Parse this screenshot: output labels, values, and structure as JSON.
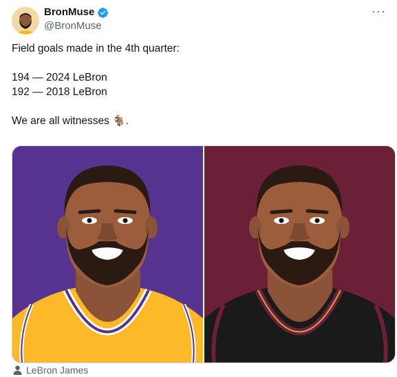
{
  "user": {
    "display_name": "BronMuse",
    "handle": "@BronMuse"
  },
  "more_label": "···",
  "tweet": {
    "line1": "Field goals made in the 4th quarter:",
    "line2": "194 — 2024 LeBron",
    "line3": "192 — 2018 LeBron",
    "line4": "We are all witnesses 🐐."
  },
  "media": {
    "left_colors": {
      "background": "#55338e",
      "jersey": "#fdb927"
    },
    "right_colors": {
      "background": "#6b2038",
      "jersey": "#1a1a1a"
    }
  },
  "tag": {
    "icon": "person-icon",
    "label": "LeBron James"
  },
  "colors": {
    "verified": "#1d9bf0",
    "secondary_text": "#536471"
  }
}
